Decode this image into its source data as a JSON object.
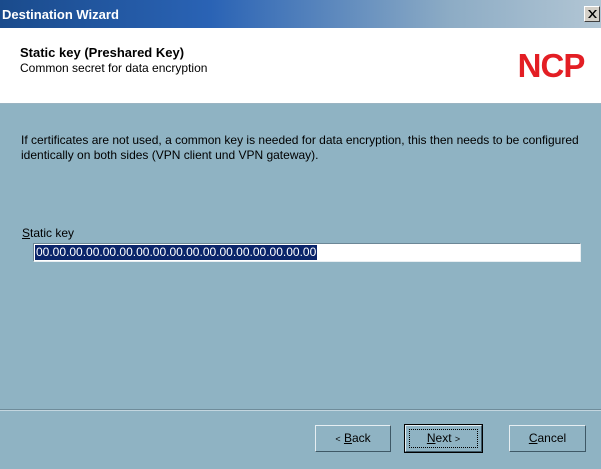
{
  "window": {
    "title": "Destination Wizard"
  },
  "header": {
    "title": "Static key (Preshared Key)",
    "subtitle": "Common secret for data encryption",
    "logo_text": "NCP",
    "logo_color": "#e31e24"
  },
  "body": {
    "description": "If certificates are not used, a common key is needed for data encryption, this then needs to be configured identically on both sides (VPN client und VPN gateway).",
    "static_key_label_mnemonic": "S",
    "static_key_label_rest": "tatic key",
    "static_key_value": "00.00.00.00.00.00.00.00.00.00.00.00.00.00.00.00.00"
  },
  "buttons": {
    "back_mnemonic": "B",
    "back_rest": "ack",
    "next_mnemonic": "N",
    "next_rest": "ext",
    "cancel_mnemonic": "C",
    "cancel_rest": "ancel"
  },
  "colors": {
    "background": "#8fb3c3",
    "selection": "#0a246a"
  }
}
